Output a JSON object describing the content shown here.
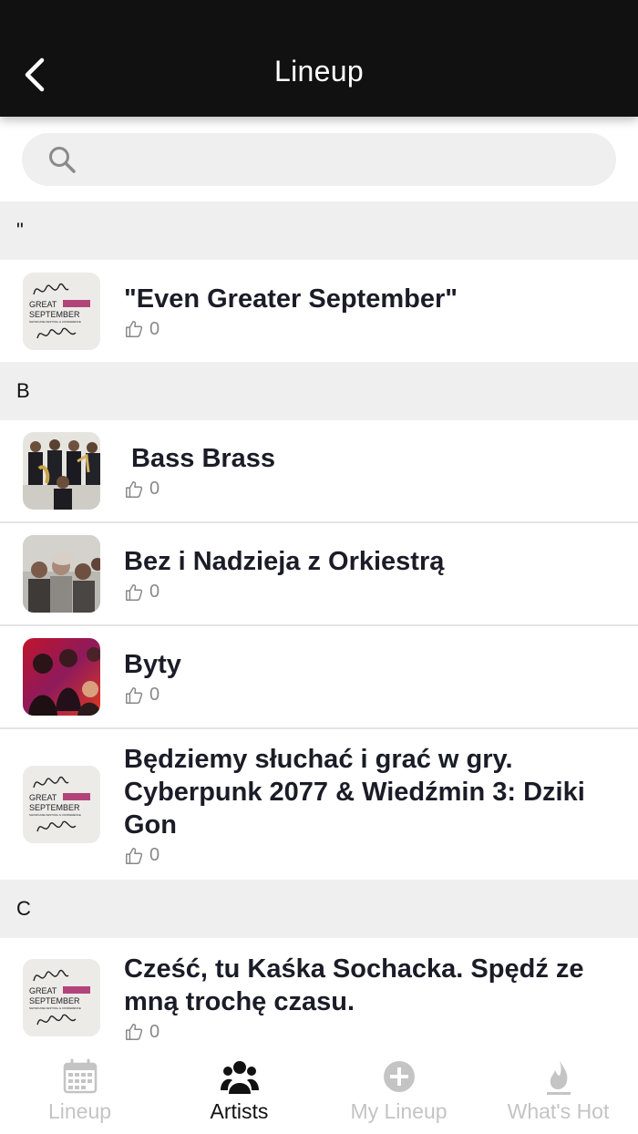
{
  "header": {
    "title": "Lineup"
  },
  "search": {
    "placeholder": ""
  },
  "sections": [
    {
      "letter": "\"",
      "artists": [
        {
          "name": "\"Even Greater September\"",
          "likes": "0",
          "thumb": "gs-logo"
        }
      ]
    },
    {
      "letter": "B",
      "artists": [
        {
          "name": " Bass Brass",
          "likes": "0",
          "thumb": "band-photo"
        },
        {
          "name": "Bez i Nadzieja z Orkiestrą",
          "likes": "0",
          "thumb": "group-photo"
        },
        {
          "name": "Byty",
          "likes": "0",
          "thumb": "red-photo"
        },
        {
          "name": "Będziemy słuchać i grać w gry. Cyberpunk 2077 & Wiedźmin 3: Dziki Gon",
          "likes": "0",
          "thumb": "gs-logo"
        }
      ]
    },
    {
      "letter": "C",
      "artists": [
        {
          "name": "Cześć, tu Kaśka Sochacka. Spędź ze mną trochę czasu.",
          "likes": "0",
          "thumb": "gs-logo"
        }
      ]
    }
  ],
  "logo_text": {
    "line1": "GREAT",
    "line2": "SEPTEMBER",
    "line3": "SHOWCASE FESTIVAL & CONFERENCE"
  },
  "tabs": [
    {
      "label": "Lineup",
      "icon": "calendar-icon",
      "active": false
    },
    {
      "label": "Artists",
      "icon": "people-icon",
      "active": true
    },
    {
      "label": "My Lineup",
      "icon": "plus-circle-icon",
      "active": false
    },
    {
      "label": "What's Hot",
      "icon": "flame-icon",
      "active": false
    }
  ],
  "colors": {
    "header_bg": "#111111",
    "section_bg": "#efefef",
    "active_tab": "#111111",
    "inactive_tab": "#c4c4c4"
  }
}
